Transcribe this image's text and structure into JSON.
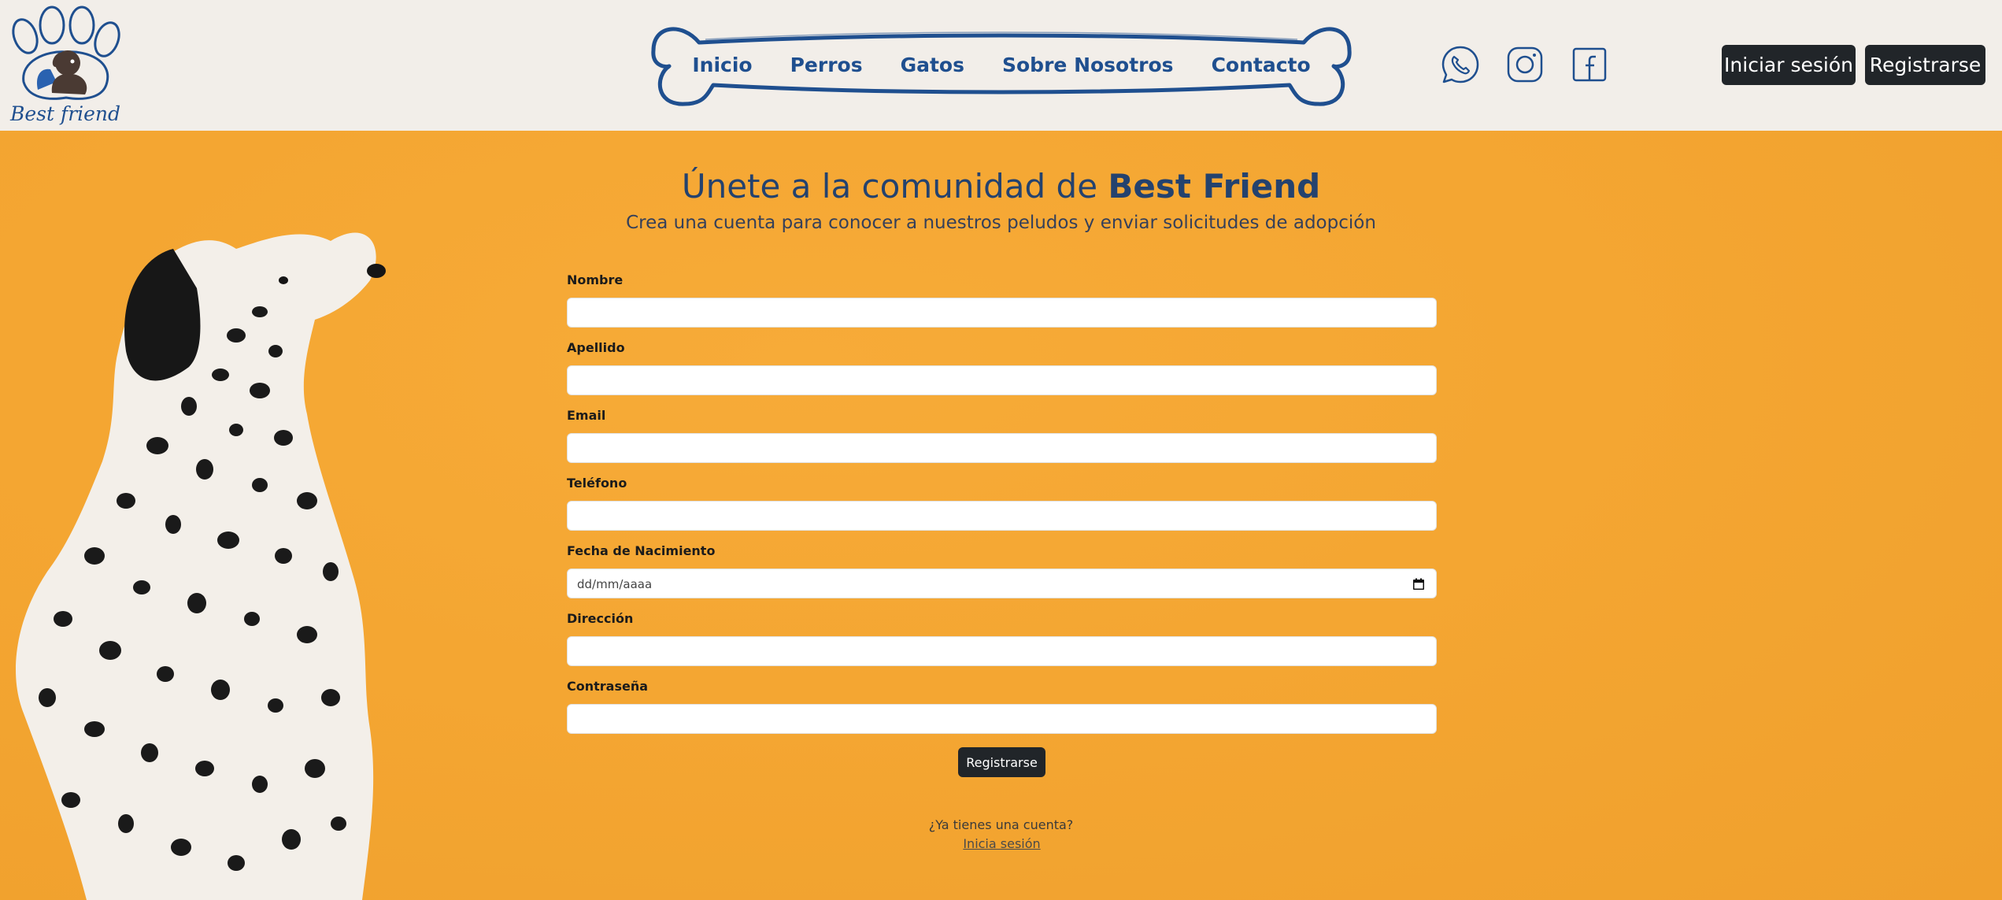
{
  "brand": {
    "name": "Best friend"
  },
  "nav": {
    "items": [
      {
        "label": "Inicio"
      },
      {
        "label": "Perros"
      },
      {
        "label": "Gatos"
      },
      {
        "label": "Sobre Nosotros"
      },
      {
        "label": "Contacto"
      }
    ]
  },
  "social": {
    "icons": [
      "whatsapp-icon",
      "instagram-icon",
      "facebook-icon"
    ]
  },
  "header_buttons": {
    "login": "Iniciar sesión",
    "register": "Registrarse"
  },
  "hero": {
    "title_prefix": "Únete a la comunidad de ",
    "title_brand": "Best Friend",
    "subtitle": "Crea una cuenta para conocer a nuestros peludos y enviar solicitudes de adopción"
  },
  "form": {
    "fields": [
      {
        "label": "Nombre",
        "value": ""
      },
      {
        "label": "Apellido",
        "value": ""
      },
      {
        "label": "Email",
        "value": ""
      },
      {
        "label": "Teléfono",
        "value": ""
      },
      {
        "label": "Fecha de Nacimiento",
        "placeholder": "dd/mm/aaaa"
      },
      {
        "label": "Dirección",
        "value": ""
      },
      {
        "label": "Contraseña",
        "value": ""
      }
    ],
    "submit_label": "Registrarse",
    "have_account_text": "¿Ya tienes una cuenta?",
    "login_link": "Inicia sesión"
  },
  "colors": {
    "background_header": "#f2eee9",
    "hero_orange": "#f4a632",
    "brand_blue": "#1f4f8f",
    "button_dark": "#212529"
  }
}
